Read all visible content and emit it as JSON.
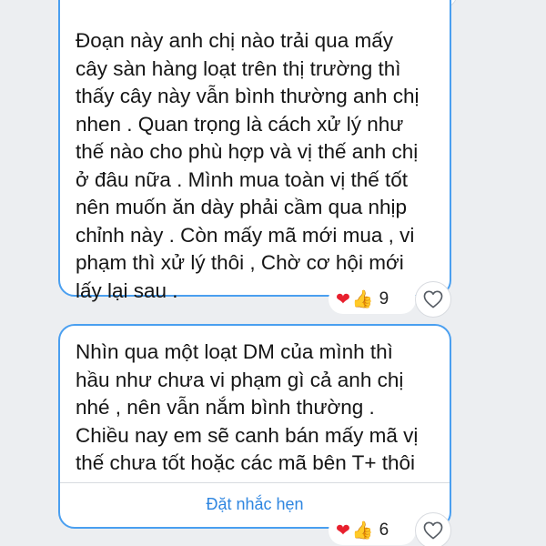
{
  "messages": [
    {
      "text": "Đoạn này anh chị nào trải qua mấy\ncây sàn hàng loạt trên thị trường thì\nthấy cây này vẫn bình thường anh chị\nnhen . Quan trọng là cách xử lý  như\nthế nào cho phù hợp và vị thế anh chị\nở đâu nữa . Mình mua toàn vị thế tốt\nnên muốn ăn dày phải cầm qua nhịp\nchỉnh này . Còn mấy mã mới mua , vi\nphạm thì xử lý thôi , Chờ cơ hội mới\nlấy lại sau .",
      "reaction_count": "9",
      "reaction_icons": [
        "heart-emoji",
        "thumbs-up-emoji"
      ]
    },
    {
      "text": "Nhìn qua một  loạt DM của mình thì\nhầu như chưa vi phạm gì cả anh chị\nnhé , nên vẫn nắm bình thường .\nChiều nay em sẽ canh bán mấy mã vị\nthế chưa tốt hoặc các mã bên T+ thôi",
      "reaction_count": "6",
      "reaction_icons": [
        "heart-emoji",
        "thumbs-up-emoji"
      ],
      "action_label": "Đặt nhắc hẹn"
    }
  ],
  "colors": {
    "background": "#eceef1",
    "bubble_border": "#4a9ff0",
    "link": "#2f86e0",
    "heart": "#e8202e",
    "thumb": "#f4b524"
  }
}
